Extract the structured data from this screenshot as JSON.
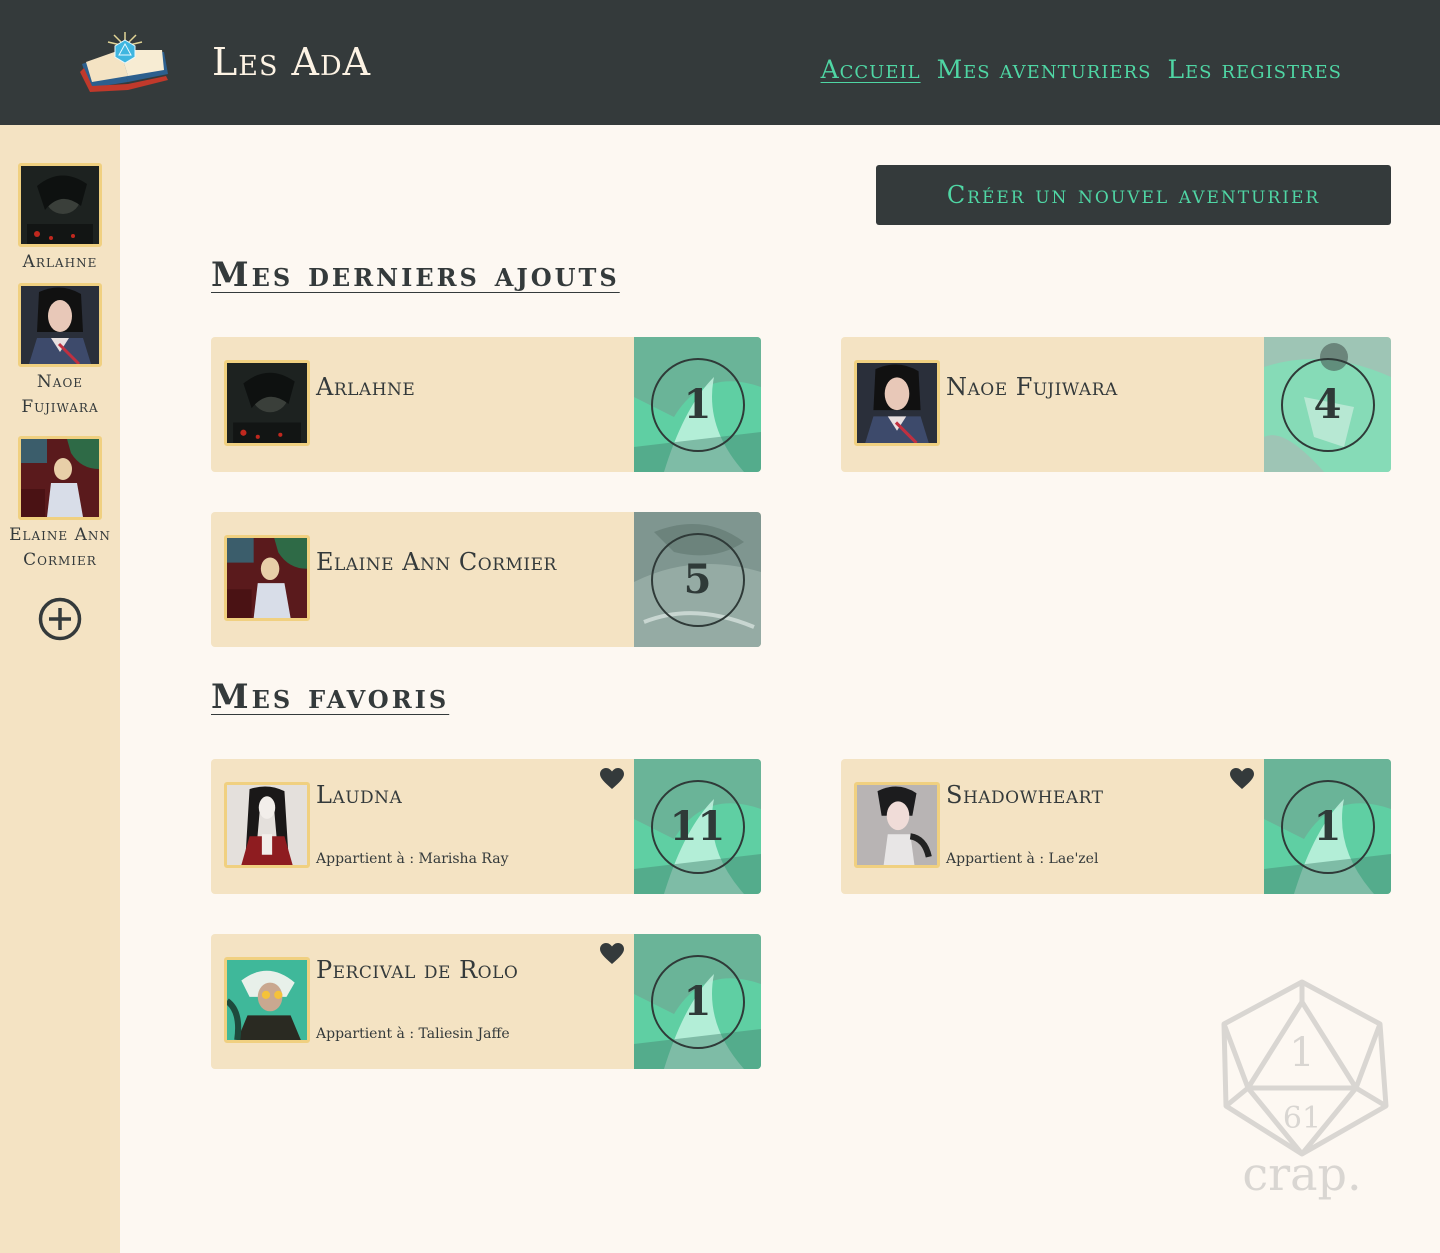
{
  "header": {
    "title": "Les AdA",
    "nav": [
      {
        "label": "Accueil",
        "active": true
      },
      {
        "label": "Mes aventuriers",
        "active": false
      },
      {
        "label": "Les registres",
        "active": false
      }
    ]
  },
  "sidebar": {
    "characters": [
      {
        "name": "Arlahne"
      },
      {
        "name": "Naoe Fujiwara"
      },
      {
        "name": "Elaine Ann Cormier"
      }
    ],
    "add_icon": "plus-circle-icon"
  },
  "create_button": "Créer un nouvel aventurier",
  "recent": {
    "title": "Mes derniers ajouts",
    "cards": [
      {
        "name": "Arlahne",
        "level": "1",
        "level_theme": "teal"
      },
      {
        "name": "Naoe Fujiwara",
        "level": "4",
        "level_theme": "teal-light"
      },
      {
        "name": "Elaine Ann Cormier",
        "level": "5",
        "level_theme": "grey"
      }
    ]
  },
  "favorites": {
    "title": "Mes favoris",
    "cards": [
      {
        "name": "Laudna",
        "owner": "Appartient à : Marisha Ray",
        "level": "11"
      },
      {
        "name": "Shadowheart",
        "owner": "Appartient à : Lae'zel",
        "level": "1"
      },
      {
        "name": "Percival de Rolo",
        "owner": "Appartient à : Taliesin Jaffe",
        "level": "1"
      }
    ]
  },
  "watermark": {
    "text": "crap.",
    "icon": "d20-dice-icon"
  },
  "colors": {
    "header_bg": "#343a3b",
    "accent": "#4fd6a4",
    "card_bg": "#f4e3c3",
    "page_bg": "#fdf8f2",
    "avatar_border": "#f0d080"
  }
}
